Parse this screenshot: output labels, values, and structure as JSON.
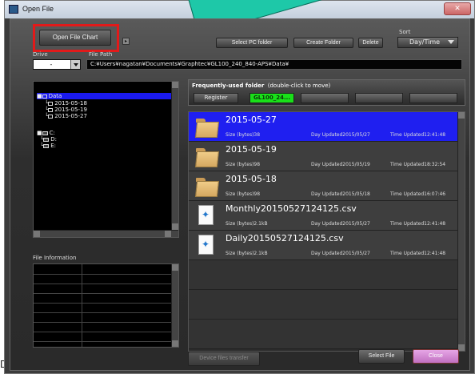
{
  "outer_letter": "D",
  "window": {
    "title": "Open File"
  },
  "toolbar": {
    "open_file_chart": "Open File Chart",
    "select_pc_folder": "Select PC folder",
    "create_folder": "Create Folder",
    "delete": "Delete",
    "sort_label": "Sort",
    "sort_value": "Day/Time"
  },
  "drive": {
    "label": "Drive",
    "value": "-"
  },
  "file_path": {
    "label": "File Path",
    "value": "C:¥Users¥nagatan¥Documents¥Graphtec¥GL100_240_840-APS¥Data¥"
  },
  "tree": {
    "root": "Data",
    "children": [
      "2015-05-18",
      "2015-05-19",
      "2015-05-27"
    ],
    "drives": [
      "C:",
      "D:",
      "E:"
    ]
  },
  "file_information": {
    "label": "File Information"
  },
  "frequent": {
    "title_bold": "Frequently-used folder",
    "title_hint": "(double-click to move)",
    "register": "Register",
    "slot_active": "GL100_24..."
  },
  "files": [
    {
      "name": "2015-05-27",
      "size": "Size (bytes)38",
      "day": "Day Updated2015/05/27",
      "time": "Time Updated12:41:48",
      "kind": "folder",
      "selected": true
    },
    {
      "name": "2015-05-19",
      "size": "Size (bytes)98",
      "day": "Day Updated2015/05/19",
      "time": "Time Updated18:32:54",
      "kind": "folder"
    },
    {
      "name": "2015-05-18",
      "size": "Size (bytes)98",
      "day": "Day Updated2015/05/18",
      "time": "Time Updated16:07:46",
      "kind": "folder"
    },
    {
      "name": "Monthly20150527124125.csv",
      "size": "Size (bytes)2.1kB",
      "day": "Day Updated2015/05/27",
      "time": "Time Updated12:41:48",
      "kind": "csv"
    },
    {
      "name": "Daily20150527124125.csv",
      "size": "Size (bytes)2.1kB",
      "day": "Day Updated2015/05/27",
      "time": "Time Updated12:41:48",
      "kind": "csv"
    }
  ],
  "bottom": {
    "device_transfer": "Device files transfer",
    "select_file": "Select File",
    "close": "Close"
  },
  "colors": {
    "highlight_box": "#e21a1a",
    "selection_blue": "#1f1ff0",
    "freq_active": "#19e019",
    "close_button": "#d88ad8",
    "callout_arrow": "#1ec8a8"
  }
}
